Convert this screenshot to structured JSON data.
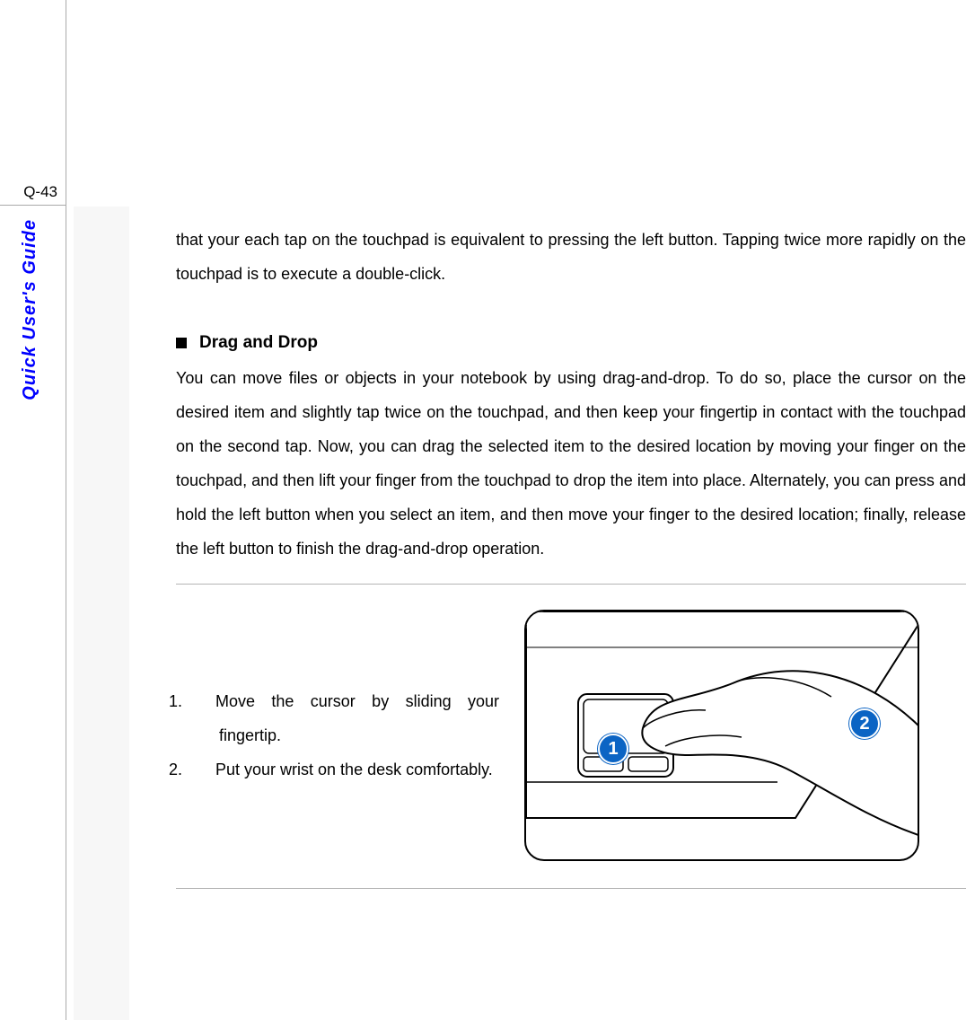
{
  "page_number": "Q-43",
  "side_label": "Quick User's Guide",
  "content": {
    "intro_continuation": "that your each tap on the touchpad is equivalent to pressing the left button.   Tapping twice more rapidly on the touchpad is to execute a double-click.",
    "section_title": "Drag and Drop",
    "section_body": "You can move files or objects in your notebook by using drag-and-drop.   To do so, place the cursor on the desired item and slightly tap twice on the touchpad, and then keep your fingertip in contact with the touchpad on the second tap.   Now, you can drag the selected item to the desired location by moving your finger on the touchpad, and then lift your finger from the touchpad to drop the item into place.   Alternately, you can press and hold the left button when you select an item, and then move your finger to the desired location; finally, release the left button to finish the drag-and-drop operation.",
    "steps": [
      {
        "num": "1.",
        "text": "Move the cursor by sliding your fingertip."
      },
      {
        "num": "2.",
        "text": "Put your wrist on the desk comfortably."
      }
    ],
    "badges": {
      "one": "1",
      "two": "2"
    }
  }
}
